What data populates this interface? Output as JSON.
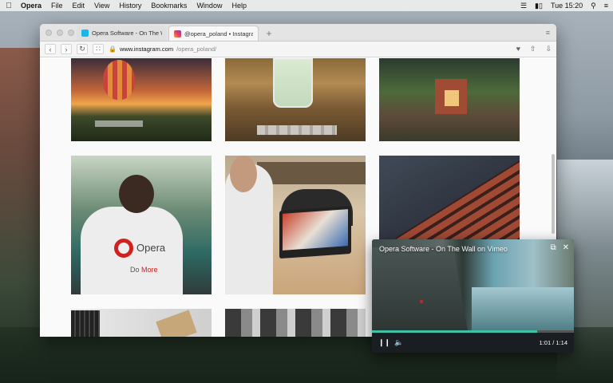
{
  "menubar": {
    "app": "Opera",
    "items": [
      "File",
      "Edit",
      "View",
      "History",
      "Bookmarks",
      "Window",
      "Help"
    ],
    "clock": "Tue 15:20"
  },
  "browser": {
    "tabs": [
      {
        "title": "Opera Software - On The Wall"
      },
      {
        "title": "@opera_poland • Instagram p"
      }
    ],
    "new_tab": "+",
    "url": {
      "host": "www.instagram.com",
      "path": "/opera_poland/"
    }
  },
  "page": {
    "photo_texts": {
      "brand": "Opera",
      "slogan_a": "Do ",
      "slogan_b": "More"
    }
  },
  "video": {
    "title": "Opera Software - On The Wall on Vimeo",
    "time": "1:01 / 1:14",
    "progress": 0.82,
    "accent": "#3cc3a7"
  }
}
